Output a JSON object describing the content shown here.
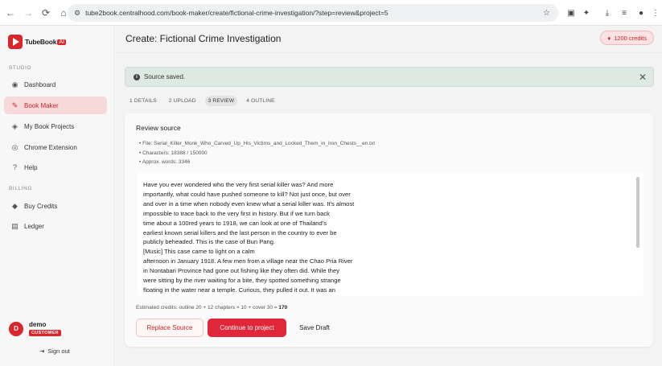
{
  "browser": {
    "url": "tube2book.centralhood.com/book-maker/create/fictional-crime-investigation/?step=review&project=5"
  },
  "sidebar": {
    "logo_text": "TubeBook",
    "logo_badge": "AI",
    "studio_label": "STUDIO",
    "billing_label": "BILLING",
    "items": [
      {
        "label": "Dashboard",
        "icon": "dashboard-icon"
      },
      {
        "label": "Book Maker",
        "icon": "magic-wand-icon",
        "active": true
      },
      {
        "label": "My Book Projects",
        "icon": "layers-icon"
      },
      {
        "label": "Chrome Extension",
        "icon": "chrome-icon"
      },
      {
        "label": "Help",
        "icon": "help-icon"
      }
    ],
    "billing_items": [
      {
        "label": "Buy Credits",
        "icon": "gem-icon"
      },
      {
        "label": "Ledger",
        "icon": "ledger-icon"
      }
    ],
    "user": {
      "initial": "D",
      "name": "demo",
      "role": "CUSTOMER"
    },
    "signout_label": "Sign out"
  },
  "header": {
    "title": "Create: Fictional Crime Investigation",
    "credits": "1200 credits"
  },
  "toast": {
    "message": "Source saved."
  },
  "steps": [
    {
      "label": "1 DETAILS"
    },
    {
      "label": "2 UPLOAD"
    },
    {
      "label": "3 REVIEW",
      "active": true
    },
    {
      "label": "4 OUTLINE"
    }
  ],
  "review": {
    "title": "Review source",
    "file": "File: Serial_Killer_Monk_Who_Carved_Up_His_Victims_and_Locked_Them_in_Iron_Chests__en.txt",
    "characters": "Characters: 18388 / 150000",
    "words": "Approx. words: 3346",
    "transcript": "Have you ever wondered who the very first serial killer was? And more\nimportantly, what could have pushed someone to kill? Not just once, but over\nand over in a time when nobody even knew what a serial killer was. It's almost\nimpossible to trace back to the very first in history. But if we turn back\ntime about a 100red years to 1918, we can look at one of Thailand's\nearliest known serial killers and the last person in the country to ever be\npublicly beheaded. This is the case of Bun Pang.\n[Music] This case came to light on a calm\nafternoon in January 1918. A few men from a village near the Chao Pria River\nin Nontabari Province had gone out fishing like they often did. While they\nwere sitting by the river waiting for a bite, they spotted something strange\nfloating in the water near a temple. Curious, they pulled it out. It was an",
    "estimate_prefix": "Estimated credits: outline 20 + 12 chapters × 10 + cover 30 =",
    "estimate_total": "170"
  },
  "actions": {
    "replace_label": "Replace Source",
    "continue_label": "Continue to project",
    "save_label": "Save Draft"
  }
}
